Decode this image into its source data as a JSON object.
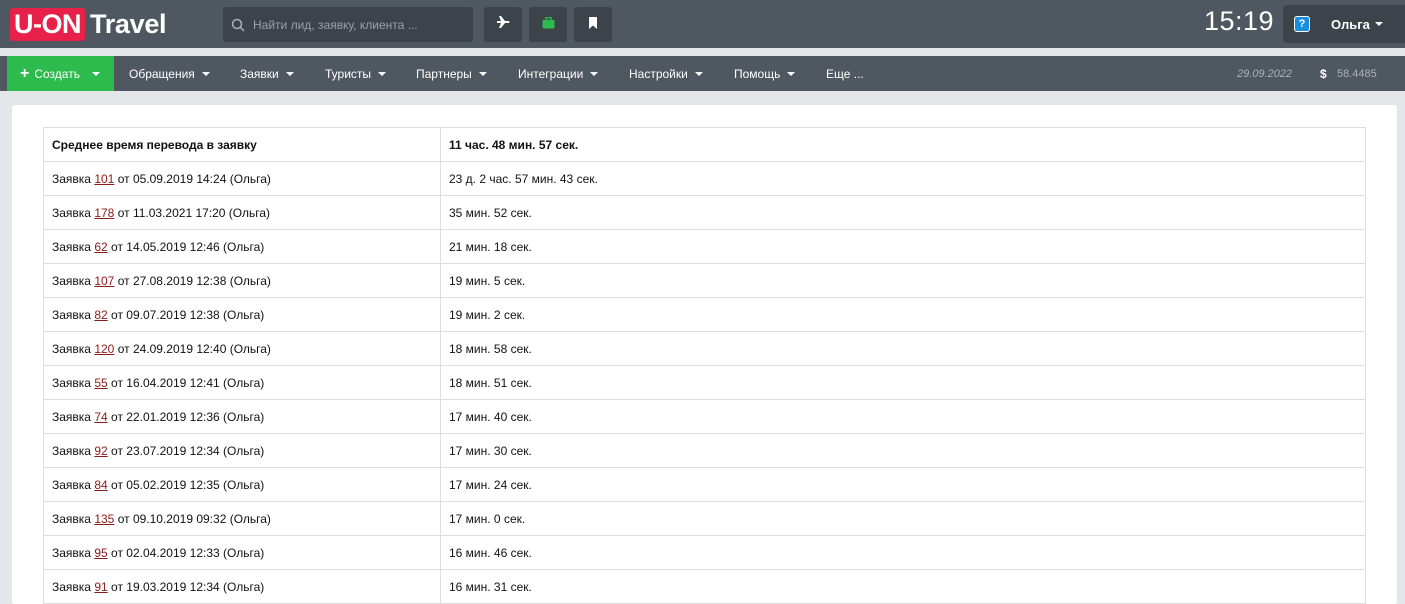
{
  "app": {
    "logo_badge": "U-ON",
    "logo_text": "Travel",
    "search_placeholder": "Найти лид, заявку, клиента ...",
    "clock": "15:19",
    "user_name": "Ольга",
    "help_icon_glyph": "?"
  },
  "icons": {
    "search": "search-icon",
    "plane": "plane-icon",
    "briefcase": "briefcase-icon",
    "bookmark": "bookmark-icon",
    "help": "help-icon"
  },
  "colors": {
    "topbar_bg": "#4f5861",
    "create_green": "#2dbb4e",
    "logo_red": "#e8214a",
    "briefcase_green": "#2dbb4e",
    "link_color": "#8b1a1a"
  },
  "nav": {
    "create_plus": "+",
    "create_label": "Создать",
    "items": [
      "Обращения",
      "Заявки",
      "Туристы",
      "Партнеры",
      "Интеграции",
      "Настройки",
      "Помощь",
      "Еще ..."
    ],
    "date": "29.09.2022",
    "currency_symbol": "$",
    "rate": "58.4485"
  },
  "report": {
    "header_label": "Среднее время перевода в заявку",
    "header_value": "11 час. 48 мин. 57 сек.",
    "request_word": "Заявка",
    "rows": [
      {
        "num": "101",
        "rest": "от 05.09.2019 14:24 (Ольга)",
        "time": "23 д. 2 час. 57 мин. 43 сек."
      },
      {
        "num": "178",
        "rest": "от 11.03.2021 17:20 (Ольга)",
        "time": "35 мин. 52 сек."
      },
      {
        "num": "62",
        "rest": "от 14.05.2019 12:46 (Ольга)",
        "time": "21 мин. 18 сек."
      },
      {
        "num": "107",
        "rest": "от 27.08.2019 12:38 (Ольга)",
        "time": "19 мин. 5 сек."
      },
      {
        "num": "82",
        "rest": "от 09.07.2019 12:38 (Ольга)",
        "time": "19 мин. 2 сек."
      },
      {
        "num": "120",
        "rest": "от 24.09.2019 12:40 (Ольга)",
        "time": "18 мин. 58 сек."
      },
      {
        "num": "55",
        "rest": "от 16.04.2019 12:41 (Ольга)",
        "time": "18 мин. 51 сек."
      },
      {
        "num": "74",
        "rest": "от 22.01.2019 12:36 (Ольга)",
        "time": "17 мин. 40 сек."
      },
      {
        "num": "92",
        "rest": "от 23.07.2019 12:34 (Ольга)",
        "time": "17 мин. 30 сек."
      },
      {
        "num": "84",
        "rest": "от 05.02.2019 12:35 (Ольга)",
        "time": "17 мин. 24 сек."
      },
      {
        "num": "135",
        "rest": "от 09.10.2019 09:32 (Ольга)",
        "time": "17 мин. 0 сек."
      },
      {
        "num": "95",
        "rest": "от 02.04.2019 12:33 (Ольга)",
        "time": "16 мин. 46 сек."
      },
      {
        "num": "91",
        "rest": "от 19.03.2019 12:34 (Ольга)",
        "time": "16 мин. 31 сек."
      }
    ]
  }
}
